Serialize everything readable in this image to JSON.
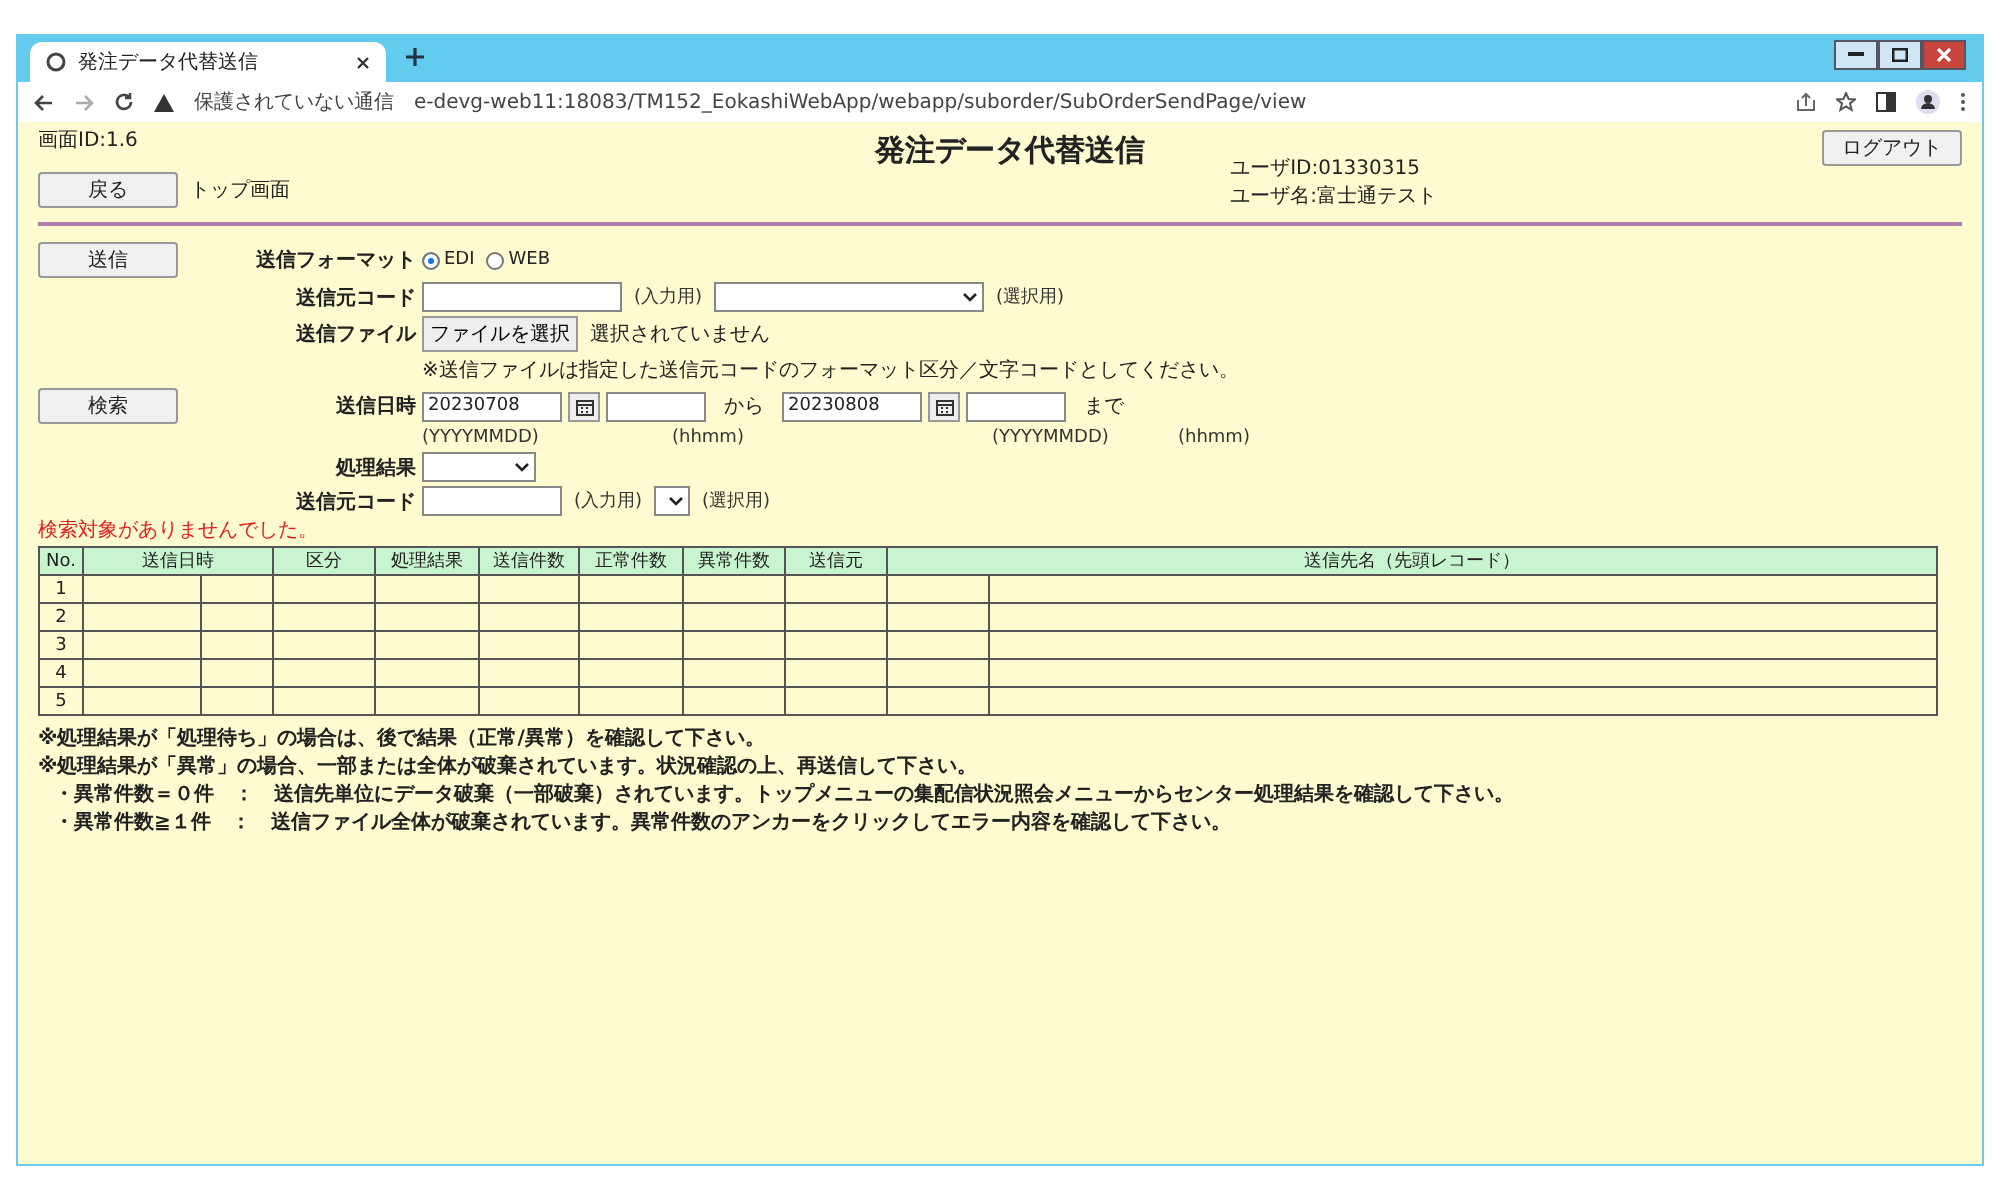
{
  "browser": {
    "tab_title": "発注データ代替送信",
    "url_warning": "保護されていない通信",
    "url": "e-devg-web11:18083/TM152_EokashiWebApp/webapp/suborder/SubOrderSendPage/view"
  },
  "header": {
    "screen_id": "画面ID:1.6",
    "title": "発注データ代替送信",
    "back_button": "戻る",
    "back_label": "トップ画面",
    "user_id": "ユーザID:01330315",
    "user_name": "ユーザ名:富士通テスト",
    "logout_button": "ログアウト"
  },
  "send_form": {
    "send_button": "送信",
    "format_label": "送信フォーマット",
    "formats": [
      {
        "label": "EDI",
        "selected": true
      },
      {
        "label": "WEB",
        "selected": false
      }
    ],
    "source_code_label": "送信元コード",
    "input_hint": "(入力用)",
    "select_hint": "(選択用)",
    "file_label": "送信ファイル",
    "file_button": "ファイルを選択",
    "file_status": "選択されていません",
    "note": "※送信ファイルは指定した送信元コードのフォーマット区分／文字コードとしてください。"
  },
  "search_form": {
    "search_button": "検索",
    "date_label": "送信日時",
    "date_from": "20230708",
    "from_word": "から",
    "date_to": "20230808",
    "to_word": "まで",
    "format_hints": [
      "(YYYYMMDD)",
      "(hhmm)",
      "(YYYYMMDD)",
      "(hhmm)"
    ],
    "result_label": "処理結果",
    "source_code_label": "送信元コード",
    "input_hint": "(入力用)",
    "select_hint": "(選択用)",
    "message": "検索対象がありませんでした。"
  },
  "table": {
    "columns": [
      "No.",
      "送信日時",
      "区分",
      "処理結果",
      "送信件数",
      "正常件数",
      "異常件数",
      "送信元",
      "送信先名（先頭レコード）"
    ],
    "rows": [
      "1",
      "2",
      "3",
      "4",
      "5"
    ]
  },
  "notes": [
    "※処理結果が「処理待ち」の場合は、後で結果（正常/異常）を確認して下さい。",
    "※処理結果が「異常」の場合、一部または全体が破棄されています。状況確認の上、再送信して下さい。",
    "・異常件数＝０件　：　送信先単位にデータ破棄（一部破棄）されています。トップメニューの集配信状況照会メニューからセンター処理結果を確認して下さい。",
    "・異常件数≧１件　：　送信ファイル全体が破棄されています。異常件数のアンカーをクリックしてエラー内容を確認して下さい。"
  ]
}
